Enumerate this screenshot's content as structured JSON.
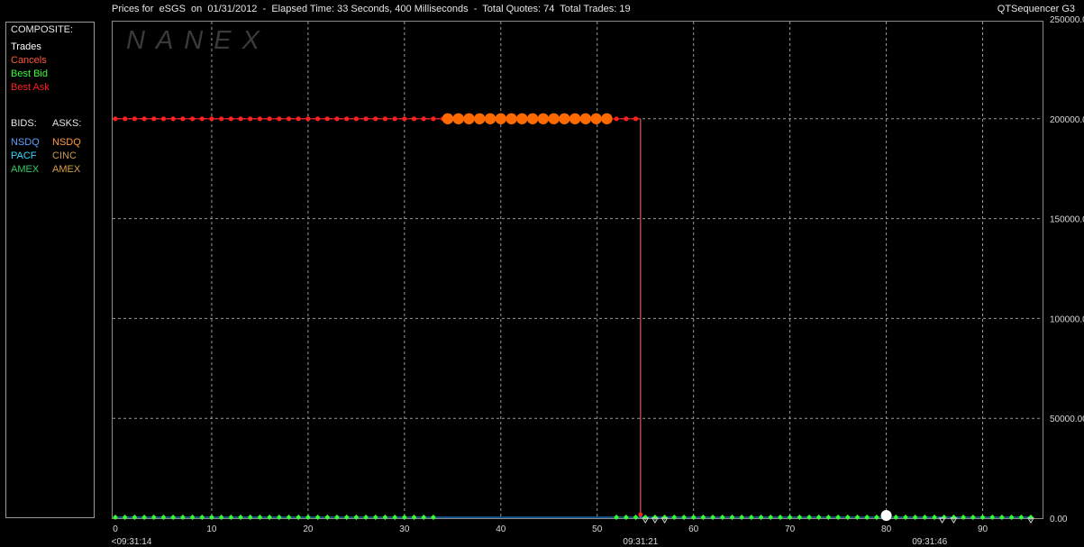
{
  "header": {
    "title": "Prices for  eSGS  on  01/31/2012  -  Elapsed Time: 33 Seconds, 400 Milliseconds  -  Total Quotes: 74  Total Trades: 19",
    "app_name": "QTSequencer G3"
  },
  "watermark": "NANEX",
  "legend": {
    "composite_title": "COMPOSITE:",
    "composite": [
      {
        "label": "Trades",
        "color": "#ffffff"
      },
      {
        "label": "Cancels",
        "color": "#ff5a3c"
      },
      {
        "label": "Best Bid",
        "color": "#33ff33"
      },
      {
        "label": "Best Ask",
        "color": "#ff2020"
      }
    ],
    "bids_title": "BIDS:",
    "asks_title": "ASKS:",
    "bids": [
      {
        "label": "NSDQ",
        "color": "#5aa0ff"
      },
      {
        "label": "PACF",
        "color": "#33d6ff"
      },
      {
        "label": "AMEX",
        "color": "#33cc66"
      }
    ],
    "asks": [
      {
        "label": "NSDQ",
        "color": "#ff9a40"
      },
      {
        "label": "CINC",
        "color": "#c89a50"
      },
      {
        "label": "AMEX",
        "color": "#d8a040"
      }
    ]
  },
  "chart_data": {
    "type": "scatter",
    "xlim": [
      0,
      95
    ],
    "ylim": [
      0,
      250000
    ],
    "x_ticks": [
      0,
      10,
      20,
      30,
      40,
      50,
      60,
      70,
      80,
      90
    ],
    "y_ticks": [
      0,
      50000,
      100000,
      150000,
      200000,
      250000
    ],
    "y_tick_labels": [
      "0.00",
      "50000.00",
      "100000.00",
      "150000.00",
      "200000.00",
      "250000.00"
    ],
    "time_labels": [
      {
        "x": 0,
        "text": "<09:31:14"
      },
      {
        "x": 54.5,
        "text": "09:31:21"
      },
      {
        "x": 84.5,
        "text": "09:31:46"
      }
    ],
    "grid": true,
    "series": [
      {
        "name": "Best Ask",
        "color": "#ff2020",
        "step_drop_at": 54.5,
        "x_range": [
          0,
          54
        ],
        "step": 1,
        "value": 200000
      },
      {
        "name": "Cancels",
        "color": "#ff6a00",
        "x_range": [
          34.5,
          51.5
        ],
        "step": 1.1,
        "value": 200000
      },
      {
        "name": "Best Bid",
        "color": "#33ff33",
        "x_range": [
          0,
          95
        ],
        "step": 1,
        "value": 0,
        "gap": [
          33.5,
          51.5
        ]
      },
      {
        "name": "Trades",
        "color": "#ffffff",
        "points": [
          {
            "x": 55,
            "y": 0
          },
          {
            "x": 56,
            "y": 0
          },
          {
            "x": 57,
            "y": 0
          },
          {
            "x": 80,
            "y": 0
          },
          {
            "x": 85.8,
            "y": 0
          },
          {
            "x": 87,
            "y": 0
          },
          {
            "x": 95,
            "y": 0
          }
        ]
      }
    ]
  }
}
